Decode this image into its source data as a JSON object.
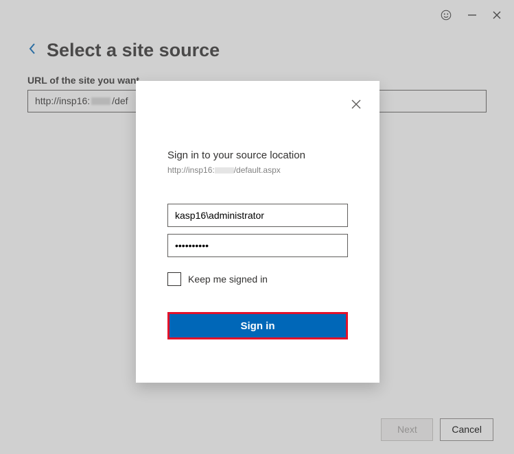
{
  "titlebar": {
    "smiley_name": "feedback-icon",
    "minimize_name": "minimize-icon",
    "close_name": "close-icon"
  },
  "header": {
    "title": "Select a site source"
  },
  "form": {
    "url_label": "URL of the site you want",
    "url_prefix": "http://insp16:",
    "url_suffix": "/def"
  },
  "dialog": {
    "title": "Sign in to your source location",
    "url_prefix": "http://insp16:",
    "url_suffix": "/default.aspx",
    "username": "kasp16\\administrator",
    "password": "••••••••••",
    "keep_signed": "Keep me signed in",
    "signin": "Sign in"
  },
  "footer": {
    "next": "Next",
    "cancel": "Cancel"
  }
}
